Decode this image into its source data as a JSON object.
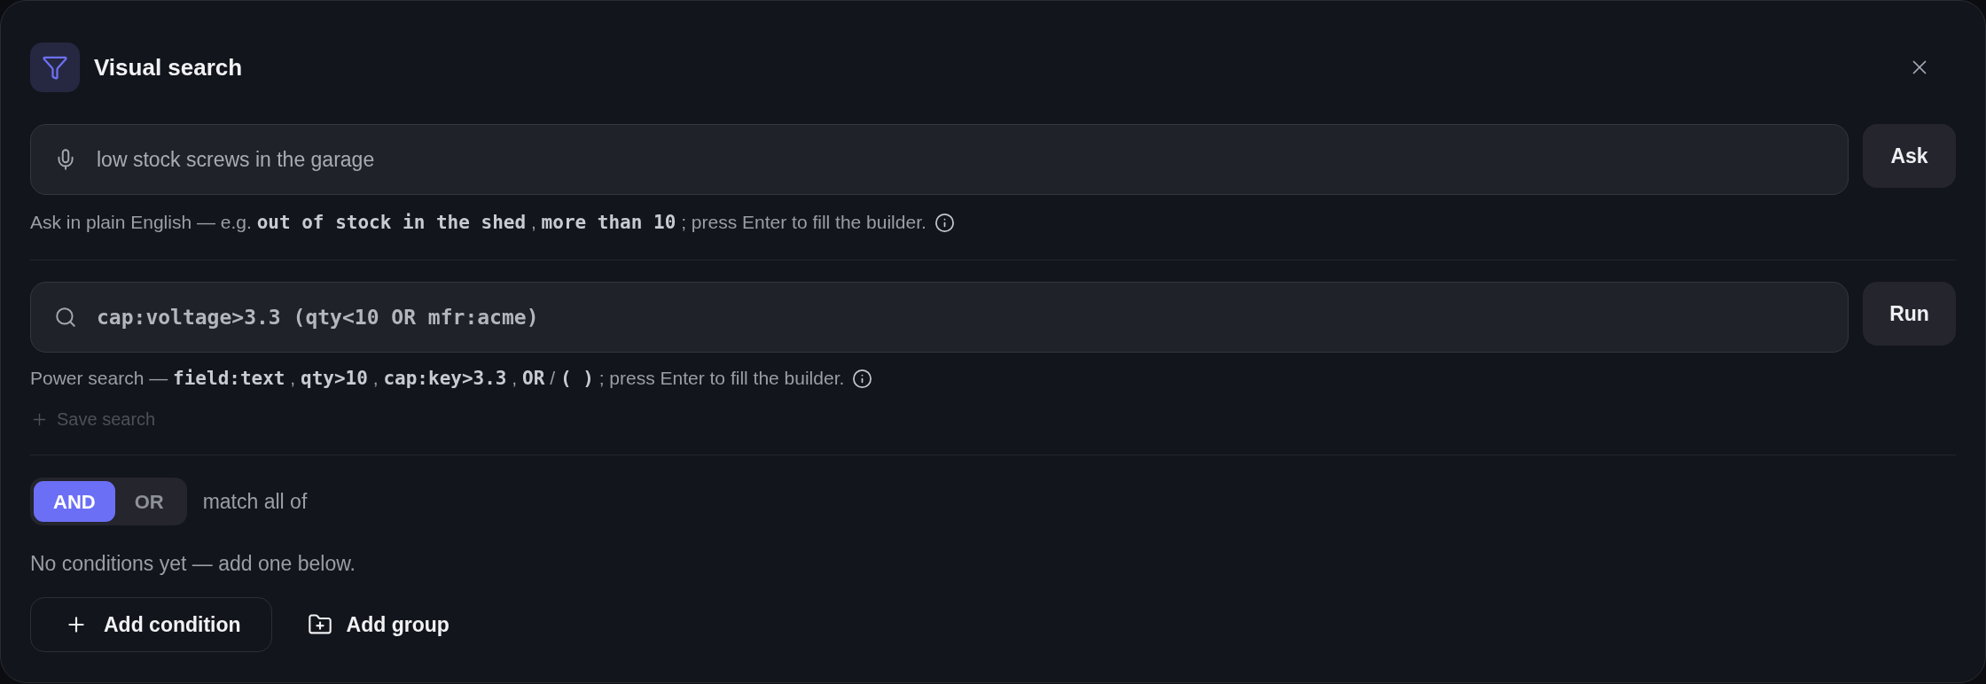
{
  "dialog": {
    "title": "Visual search"
  },
  "ask": {
    "value": "low stock screws in the garage",
    "button": "Ask",
    "hint": [
      {
        "kind": "text",
        "text": "Ask in plain English — e.g."
      },
      {
        "kind": "code",
        "text": "out of stock in the shed"
      },
      {
        "kind": "text",
        "text": ","
      },
      {
        "kind": "code",
        "text": "more than 10"
      },
      {
        "kind": "text",
        "text": "; press Enter to fill the builder."
      }
    ]
  },
  "power": {
    "value": "cap:voltage>3.3 (qty<10 OR mfr:acme)",
    "button": "Run",
    "hint": [
      {
        "kind": "text",
        "text": "Power search —"
      },
      {
        "kind": "code",
        "text": "field:text"
      },
      {
        "kind": "text",
        "text": ","
      },
      {
        "kind": "code",
        "text": "qty>10"
      },
      {
        "kind": "text",
        "text": ","
      },
      {
        "kind": "code",
        "text": "cap:key>3.3"
      },
      {
        "kind": "text",
        "text": ","
      },
      {
        "kind": "code",
        "text": "OR"
      },
      {
        "kind": "text",
        "text": "/"
      },
      {
        "kind": "code",
        "text": "( )"
      },
      {
        "kind": "text",
        "text": "; press Enter to fill the builder."
      }
    ]
  },
  "save_search": {
    "label": "Save search",
    "disabled": true
  },
  "builder": {
    "operators": [
      {
        "label": "AND",
        "selected": true
      },
      {
        "label": "OR",
        "selected": false
      }
    ],
    "match_label": "match all of",
    "empty_message": "No conditions yet — add one below.",
    "actions": [
      {
        "kind": "condition",
        "label": "Add condition"
      },
      {
        "kind": "group",
        "label": "Add group"
      }
    ]
  }
}
